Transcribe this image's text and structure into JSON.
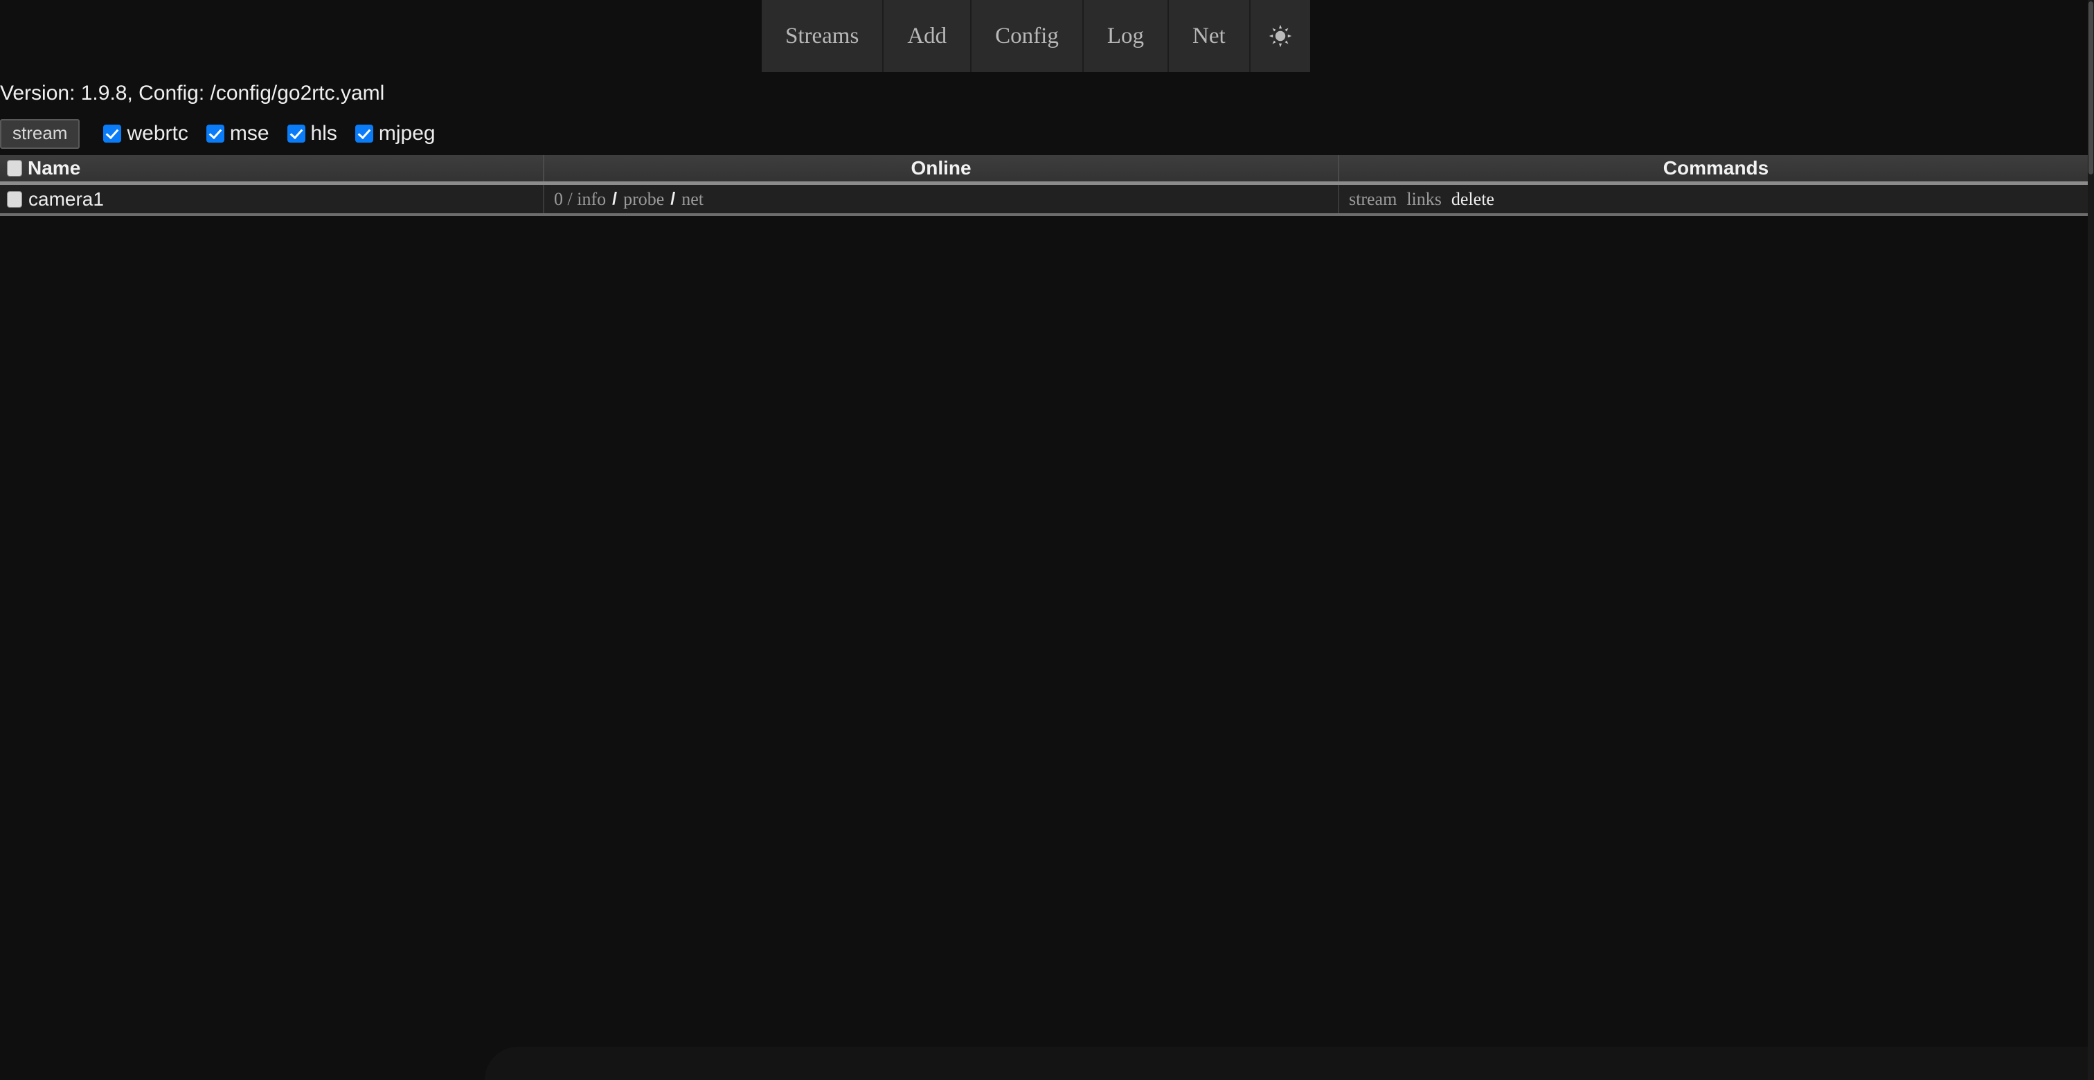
{
  "nav": {
    "items": [
      {
        "label": "Streams",
        "name": "nav-streams"
      },
      {
        "label": "Add",
        "name": "nav-add"
      },
      {
        "label": "Config",
        "name": "nav-config"
      },
      {
        "label": "Log",
        "name": "nav-log"
      },
      {
        "label": "Net",
        "name": "nav-net"
      }
    ],
    "theme_toggle_icon": "sun-icon"
  },
  "info": {
    "version_line": "Version: 1.9.8, Config: /config/go2rtc.yaml"
  },
  "controls": {
    "stream_button": "stream",
    "checkboxes": [
      {
        "label": "webrtc",
        "checked": true
      },
      {
        "label": "mse",
        "checked": true
      },
      {
        "label": "hls",
        "checked": true
      },
      {
        "label": "mjpeg",
        "checked": true
      }
    ]
  },
  "table": {
    "headers": {
      "name": "Name",
      "online": "Online",
      "commands": "Commands"
    },
    "rows": [
      {
        "name": "camera1",
        "online": {
          "count": "0 / info",
          "probe": "probe",
          "net": "net",
          "separator": "/"
        },
        "commands": {
          "stream": "stream",
          "links": "links",
          "delete": "delete"
        }
      }
    ]
  },
  "colors": {
    "page_background": "#0f0f0f",
    "nav_item_background": "#2b2b2b",
    "checkbox_accent": "#0a7cf7",
    "header_background": "#3a3a3a",
    "row_background": "#212121"
  }
}
